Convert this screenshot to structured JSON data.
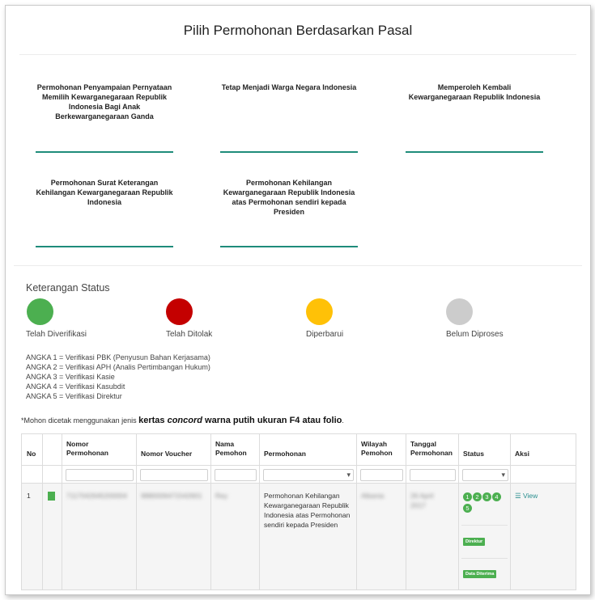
{
  "page": {
    "title": "Pilih Permohonan Berdasarkan Pasal"
  },
  "cards": [
    {
      "label": "Permohonan Penyampaian Pernyataan Memilih Kewarganegaraan Republik Indonesia Bagi Anak Berkewarganegaraan Ganda"
    },
    {
      "label": "Tetap Menjadi Warga Negara Indonesia"
    },
    {
      "label": "Memperoleh Kembali Kewarganegaraan Republik Indonesia"
    },
    {
      "label": "Permohonan Surat Keterangan Kehilangan Kewarganegaraan Republik Indonesia"
    },
    {
      "label": "Permohonan Kehilangan Kewarganegaraan Republik Indonesia atas Permohonan sendiri kepada Presiden"
    }
  ],
  "status": {
    "heading": "Keterangan Status",
    "items": [
      {
        "label": "Telah Diverifikasi",
        "color": "#4caf50"
      },
      {
        "label": "Telah Ditolak",
        "color": "#c40000"
      },
      {
        "label": "Diperbarui",
        "color": "#ffc107"
      },
      {
        "label": "Belum Diproses",
        "color": "#cccccc"
      }
    ]
  },
  "legend": [
    "ANGKA 1 = Verifikasi PBK (Penyusun Bahan Kerjasama)",
    "ANGKA 2 = Verifikasi APH (Analis Pertimbangan Hukum)",
    "ANGKA 3 = Verifikasi Kasie",
    "ANGKA 4 = Verifikasi Kasubdit",
    "ANGKA 5 = Verifikasi Direktur"
  ],
  "note": {
    "prefix": "*Mohon dicetak menggunakan jenis ",
    "bold1": "kertas ",
    "italic": "concord",
    "bold2": " warna putih ukuran F4 atau folio",
    "suffix": "."
  },
  "table": {
    "headers": {
      "no": "No",
      "nomor_permohonan": "Nomor Permohonan",
      "nomor_voucher": "Nomor Voucher",
      "nama_pemohon": "Nama Pemohon",
      "permohonan": "Permohonan",
      "wilayah_pemohon": "Wilayah Pemohon",
      "tanggal_permohonan": "Tanggal Permohonan",
      "status": "Status",
      "aksi": "Aksi"
    },
    "row": {
      "no": "1",
      "nomor_permohonan": "7117042645200004",
      "nomor_voucher": "9880006471542601",
      "nama_pemohon": "Rey",
      "permohonan": "Permohonan Kehilangan Kewarganegaraan Republik Indonesia atas Permohonan sendiri kepada Presiden",
      "wilayah_pemohon": "Albania",
      "tanggal_permohonan": "26 April 2017",
      "status_steps": [
        "1",
        "2",
        "3",
        "4",
        "5"
      ],
      "tag_1": "Direktur",
      "tag_2": "Data Diterima",
      "action": "View"
    }
  },
  "colors": {
    "accent_line": "#1f8c7a",
    "badge": "#4caf50",
    "link": "#2a8f8f"
  }
}
